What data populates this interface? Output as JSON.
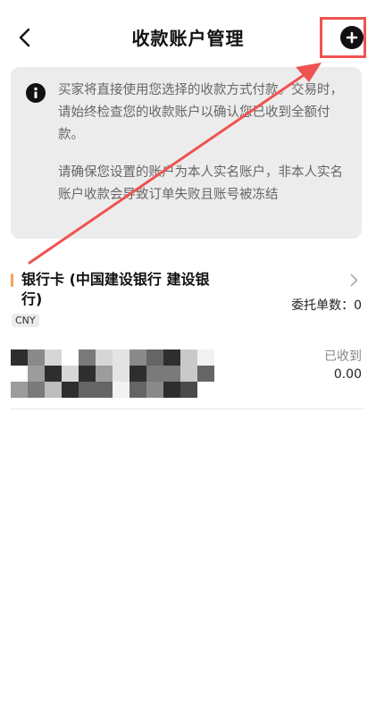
{
  "header": {
    "title": "收款账户管理",
    "back_icon": "chevron-left-icon",
    "add_icon": "plus-circle-icon"
  },
  "notice": {
    "icon": "info-icon",
    "paragraph1": "买家将直接使用您选择的收款方式付款。交易时，请始终检查您的收款账户以确认您已收到全额付款。",
    "paragraph2": "请确保您设置的账户为本人实名账户，非本人实名账户收款会导致订单失败且账号被冻结"
  },
  "account": {
    "name": "银行卡 (中国建设银行 建设银行)",
    "order_count": "委托单数：0",
    "currency": "CNY",
    "received_label": "已收到",
    "received_value": "0.00"
  },
  "colors": {
    "accent": "#f0a35a",
    "annotation": "#ef5350",
    "notice_bg": "#ececec"
  }
}
